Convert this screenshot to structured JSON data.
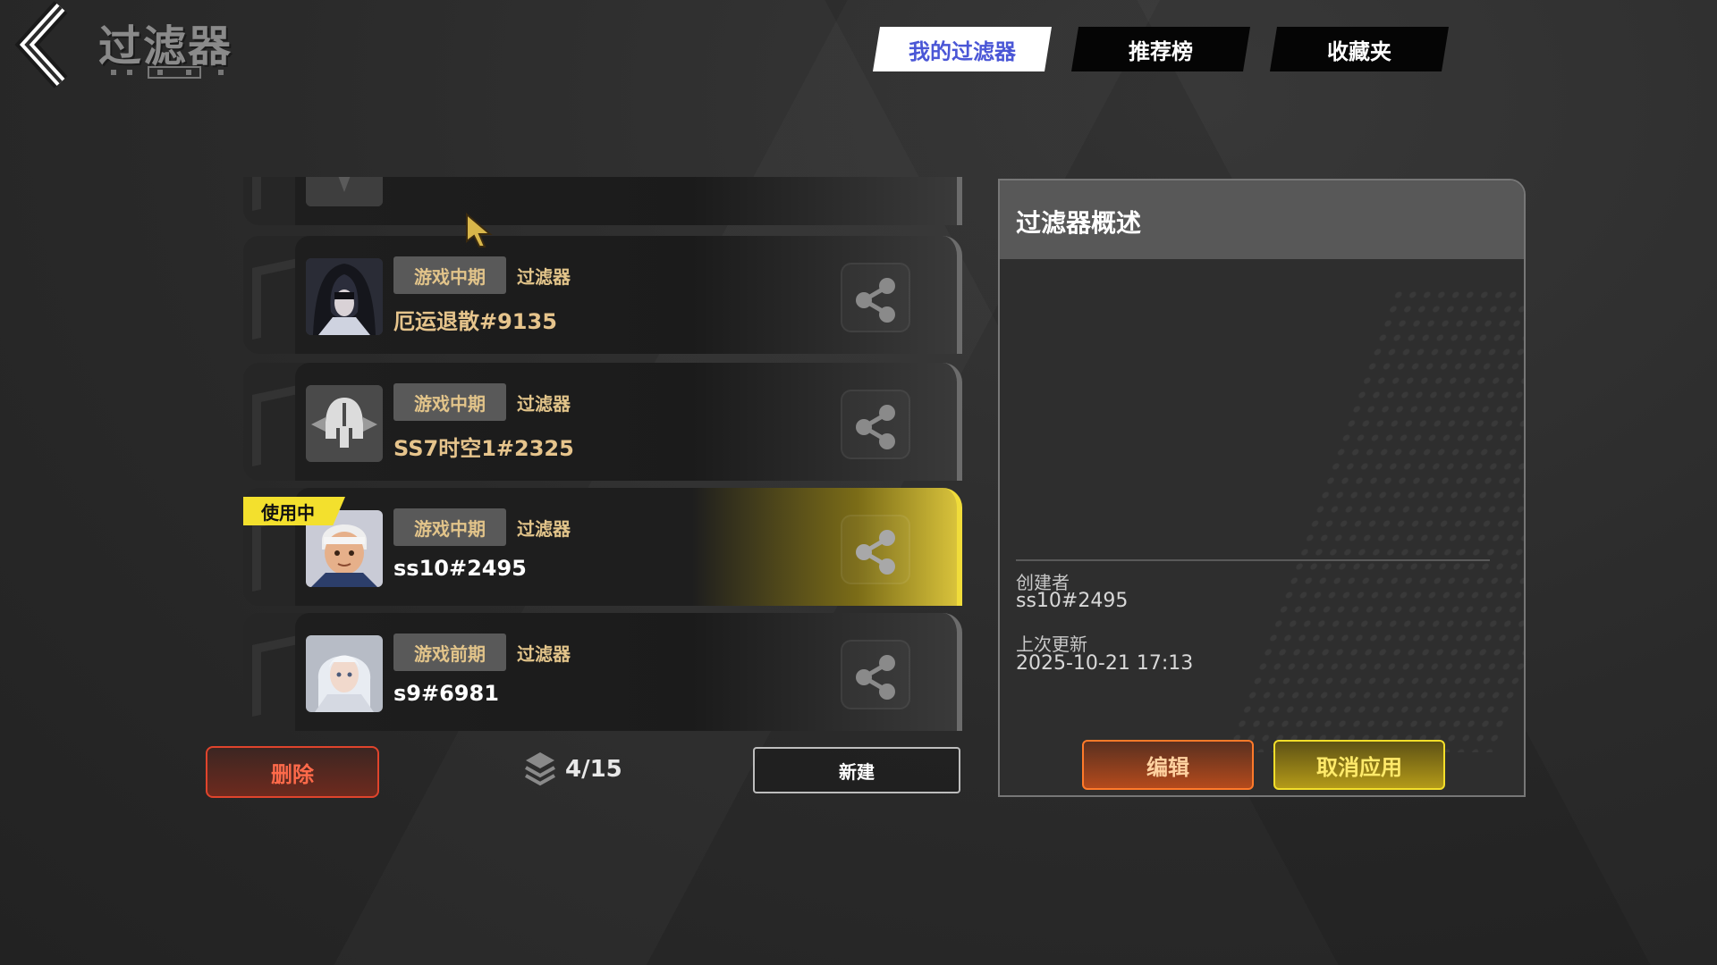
{
  "header": {
    "title": "过滤器"
  },
  "tabs": [
    {
      "label": "我的过滤器",
      "active": true
    },
    {
      "label": "推荐榜",
      "active": false
    },
    {
      "label": "收藏夹",
      "active": false
    }
  ],
  "filters": [
    {
      "stage": "游戏中期",
      "type": "过滤器",
      "name": "厄运退散#9135",
      "in_use": false
    },
    {
      "stage": "游戏中期",
      "type": "过滤器",
      "name": "SS7时空1#2325",
      "in_use": false
    },
    {
      "stage": "游戏中期",
      "type": "过滤器",
      "name": "ss10#2495",
      "in_use": true
    },
    {
      "stage": "游戏前期",
      "type": "过滤器",
      "name": "s9#6981",
      "in_use": false
    }
  ],
  "in_use_label": "使用中",
  "bottom": {
    "delete_label": "删除",
    "count": "4/15",
    "new_label": "新建"
  },
  "detail": {
    "title": "过滤器概述",
    "creator_label": "创建者",
    "creator_value": "ss10#2495",
    "updated_label": "上次更新",
    "updated_value": "2025-10-21 17:13",
    "edit_label": "编辑",
    "unapply_label": "取消应用"
  },
  "colors": {
    "accent_yellow": "#f3e02d",
    "tab_active_text": "#4a56d6",
    "delete_red": "#e0442c",
    "edit_orange": "#ff7a2a"
  }
}
